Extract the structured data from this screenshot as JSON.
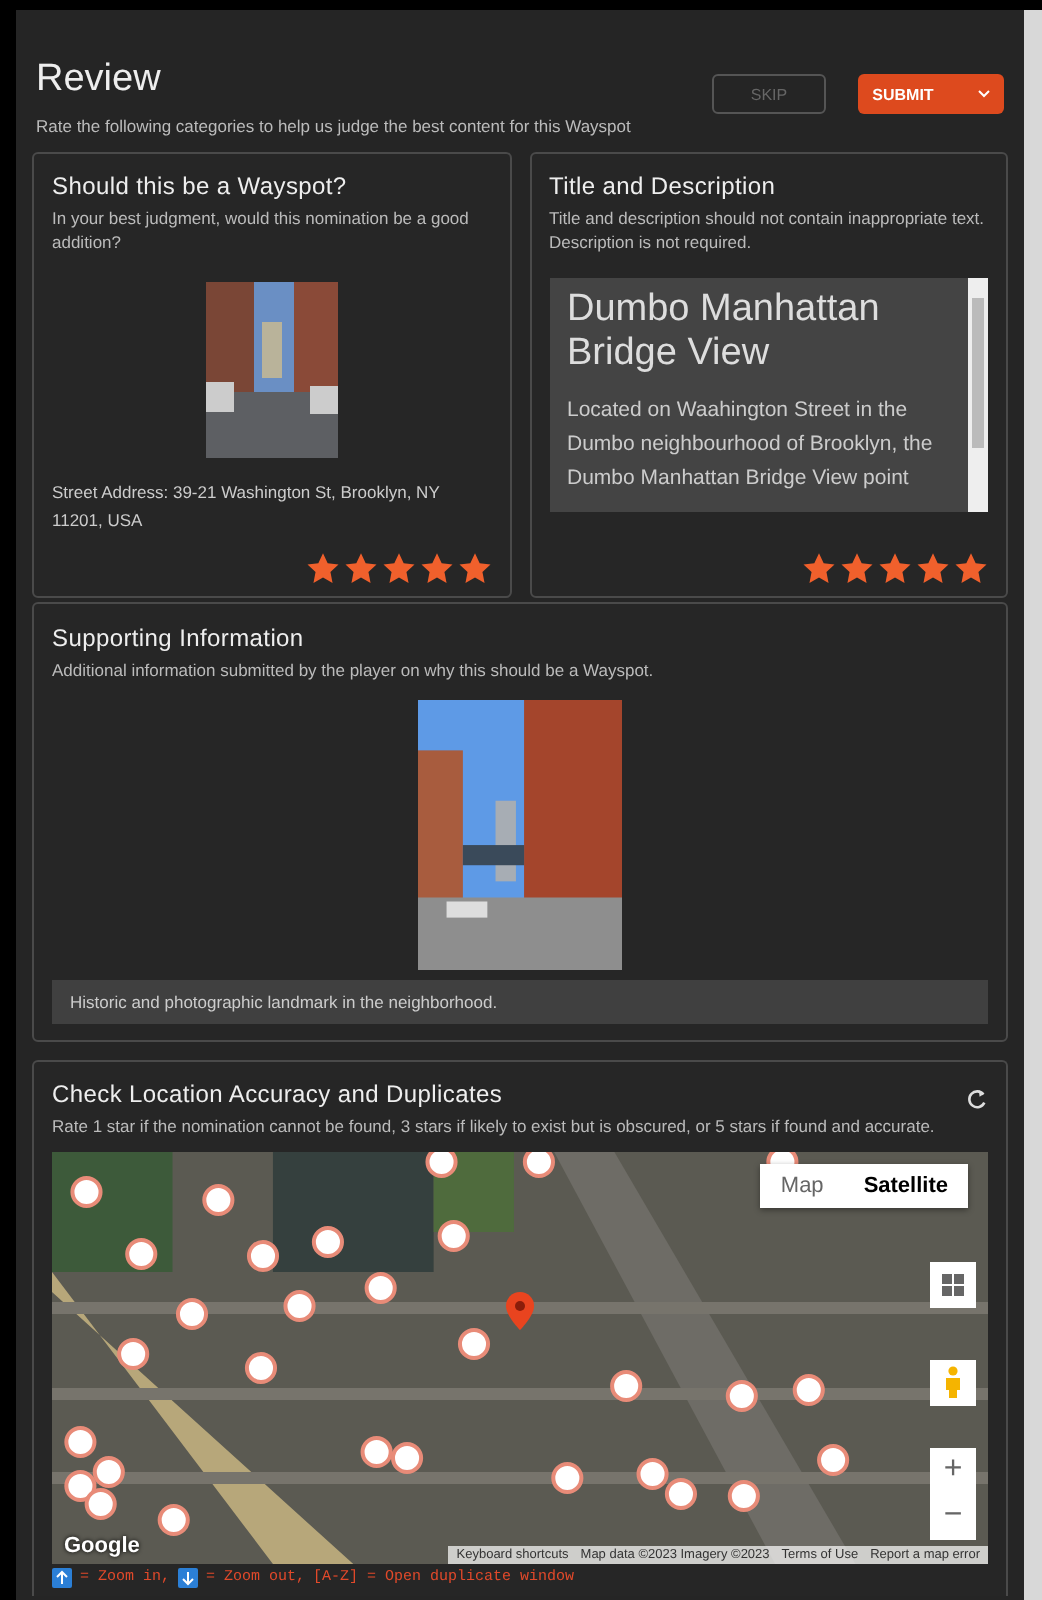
{
  "header": {
    "title": "Review",
    "subtitle": "Rate the following categories to help us judge the best content for this Wayspot",
    "buttons": [
      {
        "label": "SKIP",
        "kind": "secondary",
        "disabled": true
      },
      {
        "label": "SUBMIT",
        "kind": "primary",
        "disabled": false
      }
    ]
  },
  "cards": [
    {
      "kind": "photo",
      "title": "Should this be a Wayspot?",
      "hint": "In your best judgment, would this nomination be a good addition?",
      "address": "Street Address: 39-21 Washington St, Brooklyn, NY 11201, USA",
      "stars": 5
    },
    {
      "kind": "text",
      "title": "Title and Description",
      "hint": "Title and description should not contain inappropriate text. Description is not required.",
      "name": "Dumbo Manhattan Bridge View",
      "description": "Located on Waahington Street in the Dumbo neighbourhood of Brooklyn, the Dumbo Manhattan Bridge View point",
      "stars": 5
    }
  ],
  "supporting": {
    "title": "Supporting Information",
    "hint": "Additional information submitted by the player on why this should be a Wayspot.",
    "statement": "Historic and photographic landmark in the neighborhood."
  },
  "location": {
    "title": "Check Location Accuracy and Duplicates",
    "hint": "Rate 1 star if the nomination cannot be found, 3 stars if likely to exist but is obscured, or 5 stars if found and accurate.",
    "map_types": [
      {
        "label": "Map",
        "selected": false
      },
      {
        "label": "Satellite",
        "selected": true
      }
    ],
    "zoom_buttons": [
      "+",
      "−"
    ],
    "logo": "Google",
    "attribution": [
      "Keyboard shortcuts",
      "Map data ©2023 Imagery ©2023",
      "Terms of Use",
      "Report a map error"
    ],
    "legend": [
      {
        "kind": "key-up",
        "text": "= Zoom in,"
      },
      {
        "kind": "key-down",
        "text": "= Zoom out,"
      },
      {
        "kind": "plain",
        "text": "[A-Z] = Open duplicate window"
      }
    ]
  }
}
